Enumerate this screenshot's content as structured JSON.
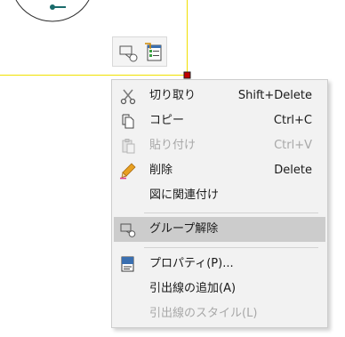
{
  "context_menu": {
    "items": [
      {
        "label": "切り取り",
        "shortcut": "Shift+Delete",
        "icon": "scissors-icon",
        "enabled": false
      },
      {
        "label": "コピー",
        "shortcut": "Ctrl+C",
        "icon": "copy-icon",
        "enabled": true
      },
      {
        "label": "貼り付け",
        "shortcut": "Ctrl+V",
        "icon": "paste-icon",
        "enabled": false
      },
      {
        "label": "削除",
        "shortcut": "Delete",
        "icon": "pencil-icon",
        "enabled": true
      },
      {
        "label": "図に関連付け",
        "shortcut": "",
        "icon": "",
        "enabled": true
      },
      {
        "label": "グループ解除",
        "shortcut": "",
        "icon": "ungroup-icon",
        "enabled": true,
        "highlighted": true
      },
      {
        "label": "プロパティ(P)...",
        "shortcut": "",
        "icon": "properties-icon",
        "enabled": true
      },
      {
        "label": "引出線の追加(A)",
        "shortcut": "",
        "icon": "",
        "enabled": true
      },
      {
        "label": "引出線のスタイル(L)",
        "shortcut": "",
        "icon": "",
        "enabled": false
      }
    ]
  },
  "mini_toolbar": {
    "buttons": [
      {
        "icon": "ungroup-icon"
      },
      {
        "icon": "format-list-icon"
      }
    ]
  },
  "colors": {
    "selection_outline": "#f0e000",
    "handle": "#c00000",
    "menu_background": "#f2f2f2",
    "highlight": "#cccccc",
    "disabled_text": "#a8a8a8"
  }
}
